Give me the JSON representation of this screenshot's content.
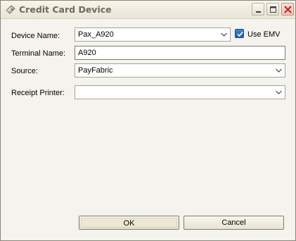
{
  "window": {
    "title": "Credit Card Device",
    "icon": "credit-card-device-icon",
    "controls": [
      "minimize-icon",
      "maximize-icon",
      "close-icon"
    ]
  },
  "form": {
    "device_name": {
      "label": "Device Name:",
      "value": "Pax_A920"
    },
    "use_emv": {
      "label": "Use EMV",
      "checked": true
    },
    "terminal_name": {
      "label": "Terminal Name:",
      "value": "A920"
    },
    "source": {
      "label": "Source:",
      "value": "PayFabric"
    },
    "receipt_printer": {
      "label": "Receipt Printer:",
      "value": ""
    }
  },
  "buttons": {
    "ok": "OK",
    "cancel": "Cancel"
  },
  "colors": {
    "title_text": "#6e6a5c",
    "window_bg": "#f4f3ee",
    "checkbox_fill": "#2a70c0",
    "close_button": "#d9534f"
  }
}
